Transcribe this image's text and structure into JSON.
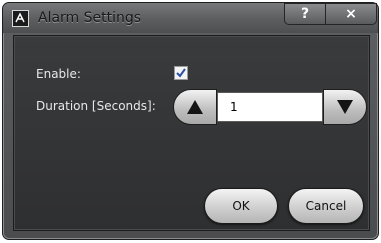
{
  "window": {
    "title": "Alarm Settings",
    "app_icon": "aeu-logo-icon",
    "help_label": "?",
    "close_label": "×"
  },
  "form": {
    "enable": {
      "label": "Enable:",
      "checked": true
    },
    "duration": {
      "label": "Duration [Seconds]:",
      "value": "1"
    }
  },
  "buttons": {
    "ok": "OK",
    "cancel": "Cancel"
  },
  "colors": {
    "frame": "#5f6062",
    "client": "#343537",
    "text": "#e8e8e8"
  }
}
